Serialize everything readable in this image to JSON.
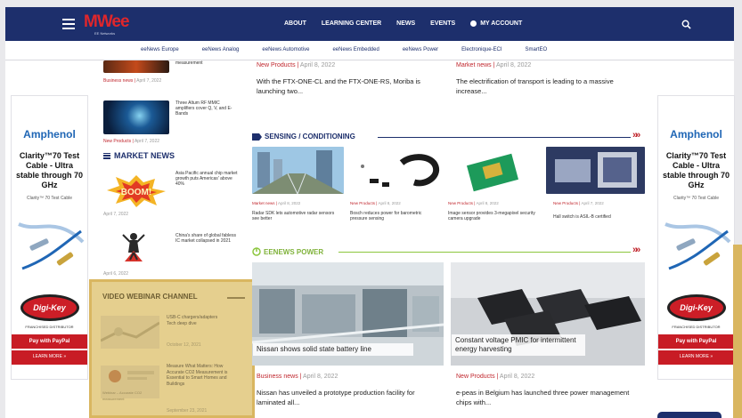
{
  "header": {
    "logo": "MWee",
    "logo_sub": "EE Networks",
    "nav": [
      "ABOUT",
      "LEARNING CENTER",
      "NEWS",
      "EVENTS"
    ],
    "account": "MY ACCOUNT"
  },
  "subnav": [
    "eeNews Europe",
    "eeNews Analog",
    "eeNews Automotive",
    "eeNews Embedded",
    "eeNews Power",
    "Electronique-ECI",
    "SmartEO"
  ],
  "ads": {
    "brand": "Amphenol",
    "headline": "Clarity™70 Test Cable - Ultra stable through 70 GHz",
    "small": "Clarity™ 70 Test Cable",
    "badge": "Digi-Key",
    "distributor": "FRANCHISED DISTRIBUTOR",
    "pay": "Pay with PayPal",
    "learn": "LEARN MORE »"
  },
  "left": {
    "item1_text": "measurement",
    "item1_cat": "Business news",
    "item1_date": "April 7, 2022",
    "item2_text": "Three Altum RF MMIC amplifiers cover Q, V, and E-Bands",
    "item2_cat": "New Products",
    "item2_date": "April 7, 2022",
    "market_head": "MARKET NEWS",
    "m1_text": "Asia Pacific annual chip market growth puts Americas' above 40%",
    "m1_date": "April 7, 2022",
    "m2_text": "China's share of global fabless IC market collapsed in 2021",
    "m2_date": "April 6, 2022"
  },
  "webinar": {
    "title": "VIDEO WEBINAR CHANNEL",
    "w1_text": "USB-C chargers/adapters Tech deep dive",
    "w1_date": "October 12, 2021",
    "w2_text": "Measure What Matters: How Accurate CO2 Measurement is Essential to Smart Homes and Buildings",
    "w2_date": "September 23, 2021",
    "w2_label": "Webinar – Accurate CO2 measurement"
  },
  "main": {
    "top_left_cat": "New Products",
    "top_left_date": "April 8, 2022",
    "top_left_text": "With the FTX-ONE-CL and the FTX-ONE-RS, Moriba is launching two...",
    "top_right_cat": "Market news",
    "top_right_date": "April 8, 2022",
    "top_right_text": "The electrification of transport is leading to a massive increase...",
    "sensing_head": "SENSING / CONDITIONING",
    "cards": [
      {
        "cat": "Market news",
        "date": "April 8, 2022",
        "text": "Radar SDK lets automotive radar sensors see better"
      },
      {
        "cat": "New Products",
        "date": "April 8, 2022",
        "text": "Bosch reduces power for barometric pressure sensing"
      },
      {
        "cat": "New Products",
        "date": "April 8, 2022",
        "text": "Image sensor provides 3-megapixel security camera upgrade"
      },
      {
        "cat": "New Products",
        "date": "April 7, 2022",
        "text": "Hall switch is ASIL-B certified"
      }
    ],
    "power_head": "EENEWS POWER",
    "big_left_caption": "Nissan shows solid state battery line",
    "big_left_cat": "Business news",
    "big_left_date": "April 8, 2022",
    "big_left_text": "Nissan has unveiled a prototype production facility for laminated all...",
    "big_right_caption": "Constant voltage PMIC for intermittent energy harvesting",
    "big_right_cat": "New Products",
    "big_right_date": "April 8, 2022",
    "big_right_text": "e-peas in Belgium has launched three power management chips with...",
    "chevrons": "»»"
  },
  "colors": {
    "nav_bg": "#1d2f6c",
    "accent_red": "#c0262d",
    "sensing_blue": "#1d2f6c",
    "power_green": "#8cc63e",
    "webinar_gold": "#e5cf8e"
  }
}
